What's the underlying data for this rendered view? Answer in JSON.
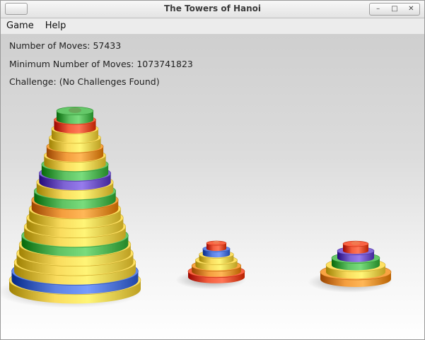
{
  "window": {
    "title": "The Towers of Hanoi",
    "controls": {
      "minimize": "–",
      "maximize": "□",
      "close": "✕"
    }
  },
  "menu": {
    "items": [
      "Game",
      "Help"
    ]
  },
  "stats": {
    "moves_label": "Number of Moves:",
    "moves_value": "57433",
    "min_moves_label": "Minimum Number of Moves:",
    "min_moves_value": "1073741823",
    "challenge_label": "Challenge:",
    "challenge_value": "(No Challenges Found)"
  },
  "colors": {
    "yellow": "#e6c84a",
    "green": "#4caf50",
    "blue": "#4a6fd0",
    "red": "#e04a2a",
    "orange": "#e08a2a",
    "purple": "#6a4fc0"
  },
  "towers": [
    {
      "name": "left",
      "disks_bottom_to_top": [
        "yellow",
        "blue",
        "yellow",
        "yellow",
        "yellow",
        "green",
        "yellow",
        "yellow",
        "yellow",
        "orange",
        "green",
        "yellow",
        "purple",
        "green",
        "yellow",
        "orange",
        "yellow",
        "yellow",
        "red",
        "green"
      ]
    },
    {
      "name": "middle",
      "disks_bottom_to_top": [
        "red",
        "orange",
        "yellow",
        "yellow",
        "blue",
        "red"
      ]
    },
    {
      "name": "right",
      "disks_bottom_to_top": [
        "orange",
        "yellow",
        "green",
        "purple",
        "red"
      ]
    }
  ]
}
